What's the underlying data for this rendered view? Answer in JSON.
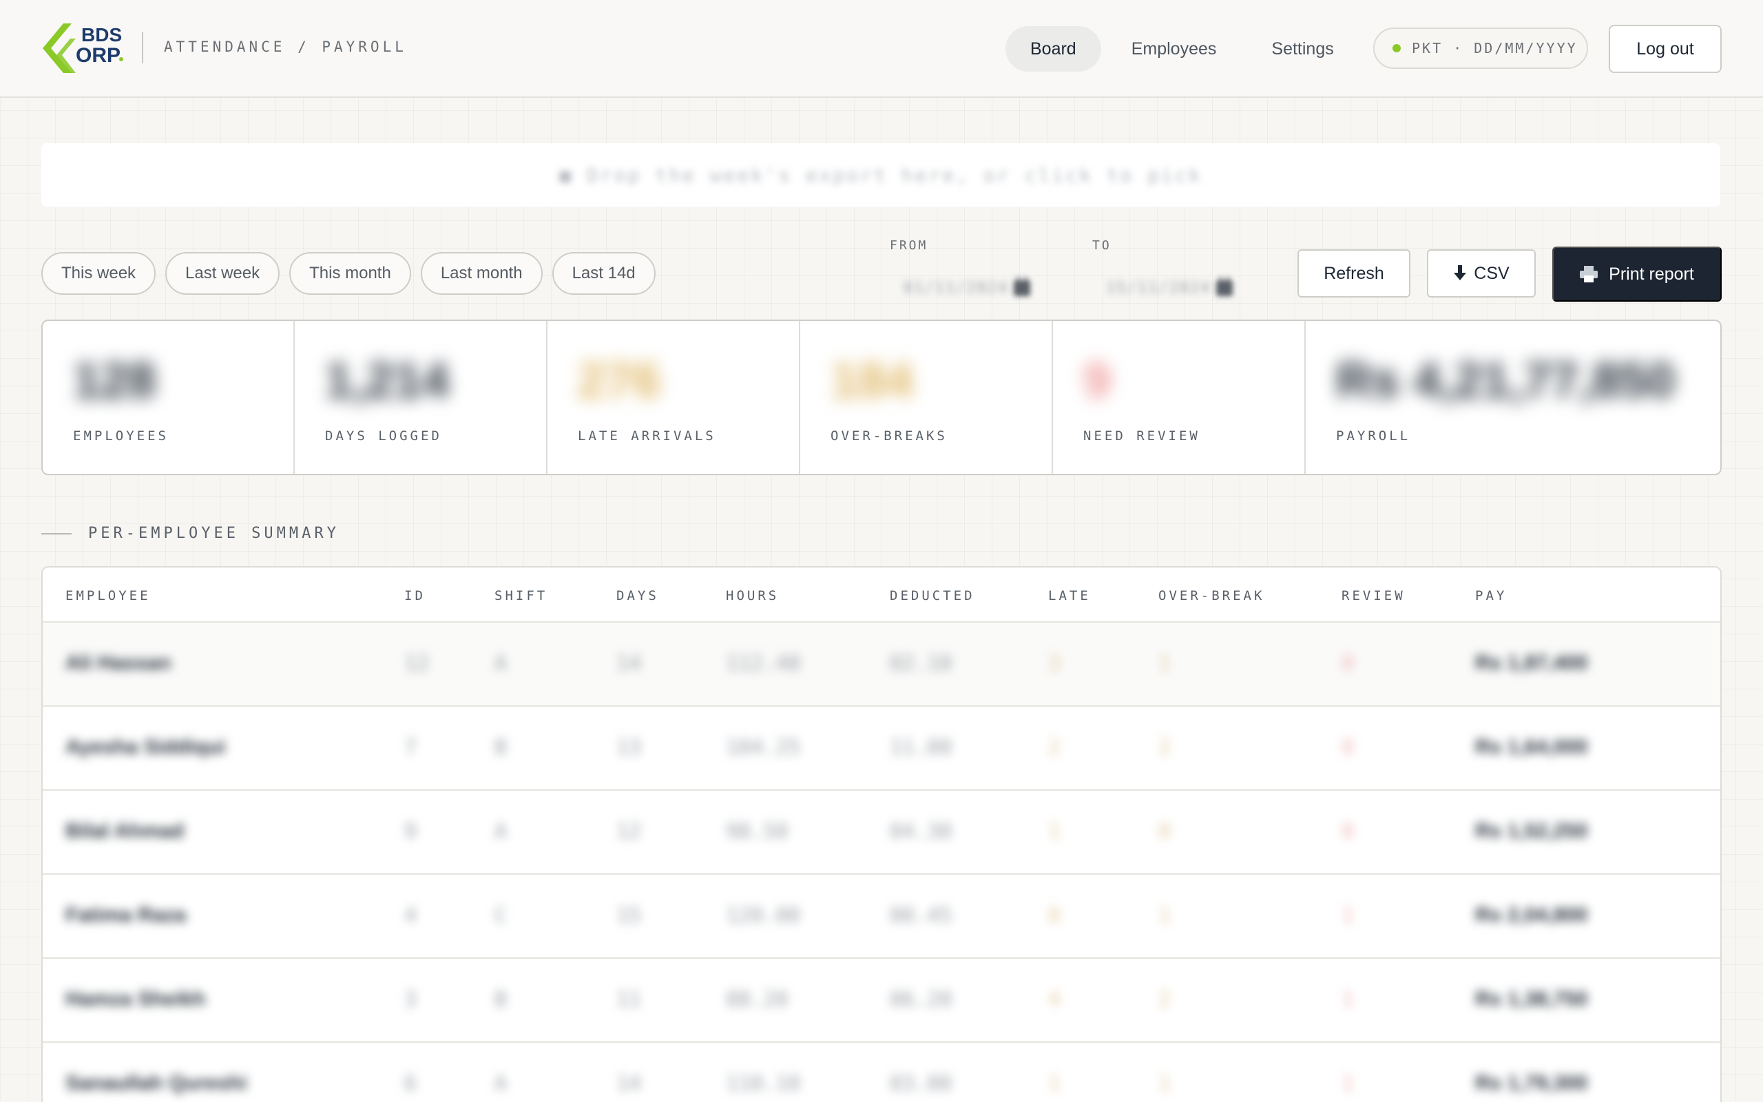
{
  "brand": {
    "logo_text_top": "BDS",
    "logo_text_bottom": "ORP",
    "breadcrumb": "ATTENDANCE / PAYROLL",
    "accent_color": "#8ac926",
    "dark_color": "#1c2531"
  },
  "nav": {
    "items": [
      {
        "label": "Board",
        "active": true
      },
      {
        "label": "Employees",
        "active": false
      },
      {
        "label": "Settings",
        "active": false
      }
    ]
  },
  "timezone": {
    "text": "PKT · DD/MM/YYYY",
    "status_color": "#8ac926"
  },
  "header": {
    "logout_label": "Log out"
  },
  "notice": {
    "text": "■ Drop the week's export here, or click to pick"
  },
  "filters": {
    "ranges": [
      "This week",
      "Last week",
      "This month",
      "Last month",
      "Last 14d"
    ],
    "from_label": "FROM",
    "to_label": "TO",
    "from_value": "01/11/2024",
    "to_value": "15/11/2024",
    "refresh_label": "Refresh",
    "csv_label": "CSV",
    "csv_icon": "download-arrow-icon",
    "print_label": "Print report",
    "print_icon": "printer-icon"
  },
  "stats": [
    {
      "label": "EMPLOYEES",
      "value": "128",
      "color": "#2a333d"
    },
    {
      "label": "DAYS LOGGED",
      "value": "1,214",
      "color": "#2a333d"
    },
    {
      "label": "LATE ARRIVALS",
      "value": "276",
      "color": "#e0b868"
    },
    {
      "label": "OVER-BREAKS",
      "value": "184",
      "color": "#e0b868"
    },
    {
      "label": "NEED REVIEW",
      "value": "9",
      "color": "#ee9a9a"
    },
    {
      "label": "PAYROLL",
      "value": "Rs 4,21,77,850",
      "color": "#2a333d"
    }
  ],
  "summary": {
    "title": "PER-EMPLOYEE SUMMARY",
    "columns": [
      "EMPLOYEE",
      "ID",
      "SHIFT",
      "DAYS",
      "HOURS",
      "DEDUCTED",
      "LATE",
      "OVER-BREAK",
      "REVIEW",
      "PAY"
    ],
    "rows": [
      [
        "Ali Hassan",
        "12",
        "A",
        "14",
        "112.40",
        "02.10",
        "3",
        "1",
        "0",
        "Rs 1,87,400"
      ],
      [
        "Ayesha Siddiqui",
        "7",
        "B",
        "13",
        "104.25",
        "11.00",
        "2",
        "2",
        "0",
        "Rs 1,64,000"
      ],
      [
        "Bilal Ahmad",
        "9",
        "A",
        "12",
        "98.50",
        "04.30",
        "1",
        "0",
        "0",
        "Rs 1,52,250"
      ],
      [
        "Fatima Raza",
        "4",
        "C",
        "15",
        "120.00",
        "00.45",
        "0",
        "1",
        "1",
        "Rs 2,04,800"
      ],
      [
        "Hamza Sheikh",
        "3",
        "B",
        "11",
        "88.20",
        "06.20",
        "4",
        "2",
        "1",
        "Rs 1,38,750"
      ],
      [
        "Sanaullah Qureshi",
        "6",
        "A",
        "14",
        "110.10",
        "03.00",
        "1",
        "1",
        "1",
        "Rs 1,79,300"
      ]
    ]
  }
}
